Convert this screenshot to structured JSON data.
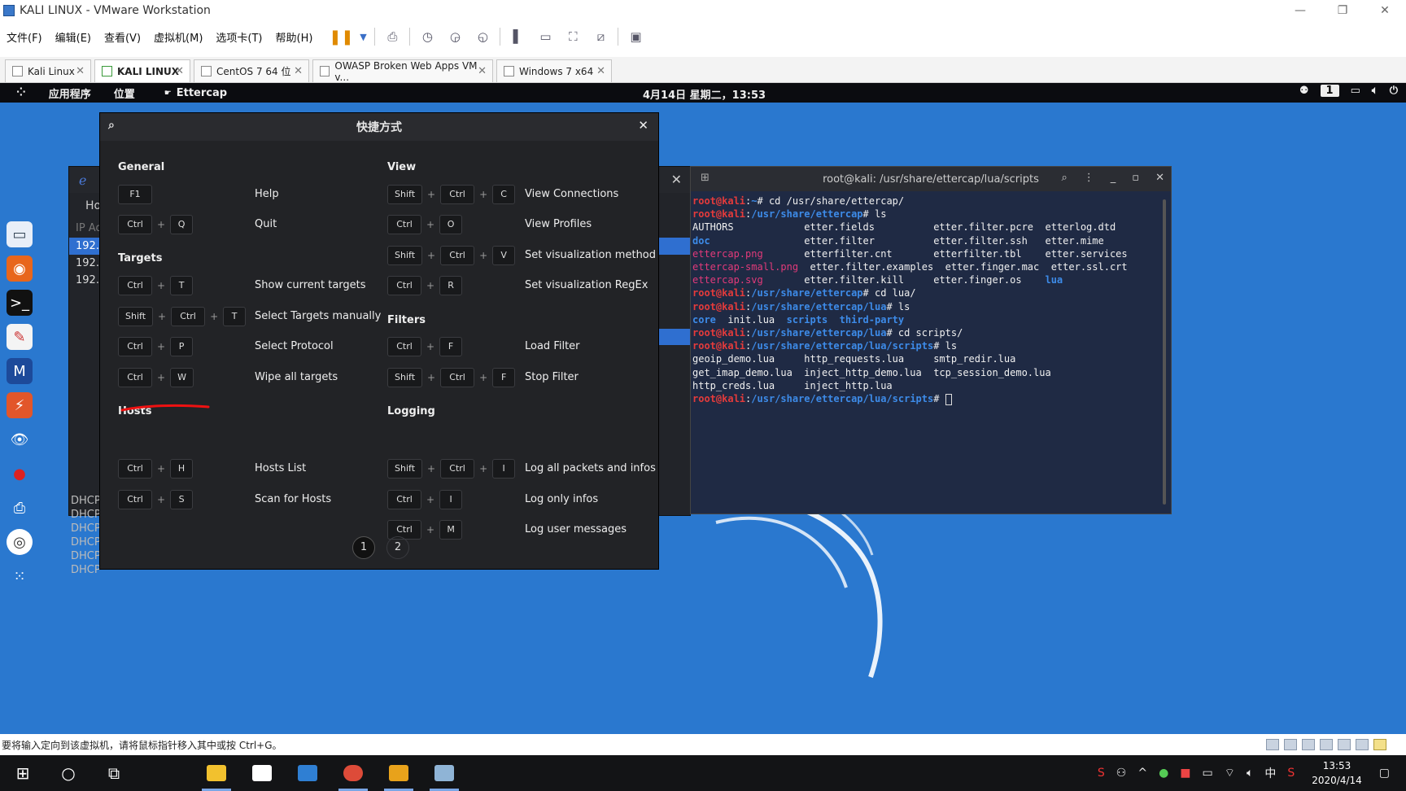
{
  "vm": {
    "title": "KALI LINUX - VMware Workstation",
    "menu": [
      "文件(F)",
      "编辑(E)",
      "查看(V)",
      "虚拟机(M)",
      "选项卡(T)",
      "帮助(H)"
    ],
    "tabs": [
      {
        "label": "Kali Linux",
        "active": false
      },
      {
        "label": "KALI LINUX",
        "active": true
      },
      {
        "label": "CentOS 7 64 位",
        "active": false
      },
      {
        "label": "OWASP Broken Web Apps VM v...",
        "active": false
      },
      {
        "label": "Windows 7 x64",
        "active": false
      }
    ],
    "status_text": "要将输入定向到该虚拟机，请将鼠标指针移入其中或按 Ctrl+G。"
  },
  "kali": {
    "apps_label": "应用程序",
    "places_label": "位置",
    "active_app": "Ettercap",
    "clock": "4月14日 星期二，13:53",
    "workspace": "1"
  },
  "ettercap": {
    "tab_label": "Ho",
    "hosts_header": "IP Ad",
    "hosts": [
      "192.1",
      "192.1",
      "192.1"
    ],
    "log_lines": [
      "DHCP",
      "DHCP",
      "DHCP",
      "DHCP",
      "DHCP",
      "DHCP"
    ]
  },
  "terminal": {
    "title": "root@kali: /usr/share/ettercap/lua/scripts"
  },
  "shortcuts": {
    "title": "快捷方式",
    "sections": {
      "general": "General",
      "targets": "Targets",
      "hosts": "Hosts",
      "view": "View",
      "filters": "Filters",
      "logging": "Logging"
    },
    "left": [
      {
        "keys": [
          "F1"
        ],
        "desc": "Help"
      },
      {
        "keys": [
          "Ctrl",
          "Q"
        ],
        "desc": "Quit"
      },
      {
        "keys": [
          "Ctrl",
          "T"
        ],
        "desc": "Show current targets"
      },
      {
        "keys": [
          "Shift",
          "Ctrl",
          "T"
        ],
        "desc": "Select Targets manually"
      },
      {
        "keys": [
          "Ctrl",
          "P"
        ],
        "desc": "Select Protocol"
      },
      {
        "keys": [
          "Ctrl",
          "W"
        ],
        "desc": "Wipe all targets"
      },
      {
        "keys": [
          "Ctrl",
          "H"
        ],
        "desc": "Hosts List"
      },
      {
        "keys": [
          "Ctrl",
          "S"
        ],
        "desc": "Scan for Hosts"
      }
    ],
    "right": [
      {
        "keys": [
          "Shift",
          "Ctrl",
          "C"
        ],
        "desc": "View Connections"
      },
      {
        "keys": [
          "Ctrl",
          "O"
        ],
        "desc": "View Profiles"
      },
      {
        "keys": [
          "Shift",
          "Ctrl",
          "V"
        ],
        "desc": "Set visualization method"
      },
      {
        "keys": [
          "Ctrl",
          "R"
        ],
        "desc": "Set visualization RegEx"
      },
      {
        "keys": [
          "Ctrl",
          "F"
        ],
        "desc": "Load Filter"
      },
      {
        "keys": [
          "Shift",
          "Ctrl",
          "F"
        ],
        "desc": "Stop Filter"
      },
      {
        "keys": [
          "Shift",
          "Ctrl",
          "I"
        ],
        "desc": "Log all packets and infos"
      },
      {
        "keys": [
          "Ctrl",
          "I"
        ],
        "desc": "Log only infos"
      },
      {
        "keys": [
          "Ctrl",
          "M"
        ],
        "desc": "Log user messages"
      }
    ],
    "pages": [
      "1",
      "2"
    ],
    "current_page": "1"
  },
  "taskbar": {
    "time": "13:53",
    "date": "2020/4/14",
    "ime": "中"
  },
  "colors": {
    "desktop_bg": "#2a78cf",
    "dialog_bg": "#222326",
    "selection": "#2f6fd0",
    "terminal_red": "#e53b3b",
    "terminal_blue": "#3d8be8"
  }
}
